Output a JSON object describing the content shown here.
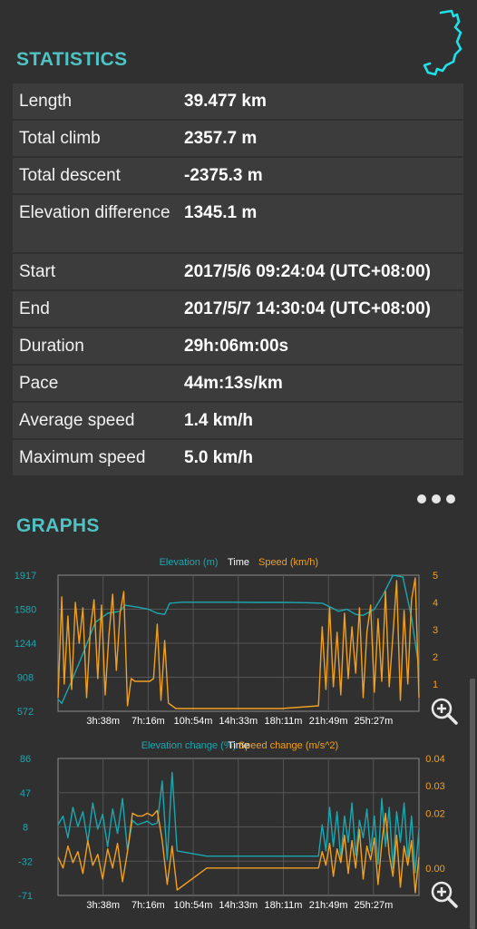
{
  "stats": {
    "title": "STATISTICS",
    "rows": [
      {
        "label": "Length",
        "value": "39.477 km"
      },
      {
        "label": "Total climb",
        "value": "2357.7 m"
      },
      {
        "label": "Total descent",
        "value": "-2375.3 m"
      },
      {
        "label": "Elevation difference",
        "value": "1345.1 m"
      },
      {
        "label": "Start",
        "value": "2017/5/6 09:24:04 (UTC+08:00)"
      },
      {
        "label": "End",
        "value": "2017/5/7 14:30:04 (UTC+08:00)"
      },
      {
        "label": "Duration",
        "value": "29h:06m:00s"
      },
      {
        "label": "Pace",
        "value": "44m:13s/km"
      },
      {
        "label": "Average speed",
        "value": "1.4 km/h"
      },
      {
        "label": "Maximum speed",
        "value": "5.0 km/h"
      }
    ]
  },
  "graphs": {
    "title": "GRAPHS"
  },
  "colors": {
    "accent": "#4fc3c3",
    "elevation": "#1aa7b0",
    "speed": "#f0a020",
    "row_bg": "#3c3c3c",
    "background": "#303030"
  },
  "chart_data": [
    {
      "type": "line",
      "legend": [
        "Elevation (m)",
        "Time",
        "Speed (km/h)"
      ],
      "x_ticks": [
        "3h:38m",
        "7h:16m",
        "10h:54m",
        "14h:33m",
        "18h:11m",
        "21h:49m",
        "25h:27m"
      ],
      "x_range_hours": [
        0,
        29.1
      ],
      "y_left_ticks": [
        "1917",
        "1580",
        "1244",
        "908",
        "572"
      ],
      "y_left_range": [
        572,
        1917
      ],
      "y_right_ticks": [
        "5",
        "4",
        "3",
        "2",
        "1"
      ],
      "y_right_range": [
        0,
        5
      ],
      "series": [
        {
          "name": "Elevation (m)",
          "axis": "left",
          "x": [
            0,
            0.3,
            1.2,
            2.2,
            3.0,
            4.0,
            5.0,
            5.4,
            6.5,
            7.3,
            8.0,
            8.6,
            9.0,
            10.0,
            12,
            14,
            16,
            18,
            20,
            21.3,
            22,
            22.6,
            23.3,
            24.0,
            24.6,
            25.5,
            26.2,
            27.0,
            27.8,
            28.5,
            29.1
          ],
          "y": [
            690,
            650,
            900,
            1200,
            1450,
            1540,
            1560,
            1620,
            1600,
            1580,
            1540,
            1530,
            1640,
            1650,
            1650,
            1650,
            1648,
            1648,
            1645,
            1640,
            1600,
            1560,
            1580,
            1530,
            1520,
            1580,
            1720,
            1920,
            1900,
            1500,
            1000
          ]
        },
        {
          "name": "Speed (km/h)",
          "axis": "right",
          "x": [
            0,
            0.3,
            0.5,
            0.8,
            1.1,
            1.4,
            1.7,
            2.0,
            2.3,
            2.6,
            2.9,
            3.2,
            3.5,
            3.8,
            4.1,
            4.4,
            4.7,
            5.0,
            5.3,
            5.6,
            5.9,
            6.2,
            6.5,
            6.8,
            7.1,
            7.4,
            7.7,
            8.0,
            8.3,
            8.6,
            8.9,
            9.5,
            12,
            15,
            18,
            21.0,
            21.3,
            21.6,
            21.9,
            22.2,
            22.5,
            22.8,
            23.1,
            23.4,
            23.7,
            24.0,
            24.3,
            24.6,
            24.9,
            25.2,
            25.5,
            25.8,
            26.1,
            26.4,
            26.7,
            27.0,
            27.3,
            27.6,
            27.9,
            28.2,
            28.5,
            28.8,
            29.1
          ],
          "y": [
            0.5,
            4.2,
            1.0,
            3.5,
            0.8,
            4.0,
            2.5,
            3.8,
            0.5,
            3.0,
            4.1,
            1.2,
            3.9,
            0.6,
            2.8,
            4.3,
            1.5,
            3.6,
            4.4,
            0.2,
            1.2,
            1.1,
            1.1,
            1.1,
            1.1,
            1.1,
            1.2,
            3.2,
            0.4,
            2.6,
            0.3,
            0.1,
            0.1,
            0.1,
            0.1,
            0.2,
            3.1,
            0.8,
            3.8,
            0.9,
            2.9,
            0.6,
            3.6,
            1.2,
            3.1,
            1.4,
            3.8,
            0.5,
            2.9,
            3.9,
            0.7,
            3.4,
            1.1,
            4.4,
            0.9,
            2.8,
            4.8,
            0.4,
            3.7,
            1.0,
            4.1,
            4.9,
            0.5
          ]
        }
      ]
    },
    {
      "type": "line",
      "legend": [
        "Elevation change (%)",
        "Time",
        "Speed change (m/s^2)"
      ],
      "x_ticks": [
        "3h:38m",
        "7h:16m",
        "10h:54m",
        "14h:33m",
        "18h:11m",
        "21h:49m",
        "25h:27m"
      ],
      "x_range_hours": [
        0,
        29.1
      ],
      "y_left_ticks": [
        "86",
        "47",
        "8",
        "-32",
        "-71"
      ],
      "y_left_range": [
        -71,
        86
      ],
      "y_right_ticks": [
        "0.04",
        "0.03",
        "0.02",
        "0.00"
      ],
      "y_right_range": [
        -0.01,
        0.04
      ],
      "series": [
        {
          "name": "Elevation change (%)",
          "axis": "left",
          "x": [
            0,
            0.4,
            0.8,
            1.2,
            1.6,
            2.0,
            2.4,
            2.8,
            3.2,
            3.6,
            4.0,
            4.4,
            4.8,
            5.2,
            5.6,
            6.0,
            6.4,
            6.8,
            7.2,
            7.6,
            8.0,
            8.4,
            8.8,
            9.2,
            9.6,
            12,
            15,
            18,
            21.0,
            21.3,
            21.6,
            21.9,
            22.2,
            22.5,
            22.8,
            23.1,
            23.4,
            23.7,
            24.0,
            24.3,
            24.6,
            24.9,
            25.2,
            25.5,
            25.8,
            26.1,
            26.4,
            26.7,
            27.0,
            27.3,
            27.6,
            27.9,
            28.2,
            28.5,
            28.8,
            29.1
          ],
          "y": [
            10,
            20,
            -5,
            30,
            8,
            25,
            -10,
            35,
            5,
            22,
            -15,
            28,
            0,
            40,
            -20,
            15,
            10,
            12,
            14,
            10,
            12,
            60,
            -30,
            70,
            -20,
            -26,
            -26,
            -26,
            -26,
            10,
            -20,
            30,
            -15,
            25,
            -30,
            20,
            -10,
            35,
            -25,
            15,
            -5,
            28,
            -20,
            20,
            -35,
            40,
            -15,
            30,
            -40,
            25,
            -10,
            35,
            -30,
            20,
            -45,
            5
          ]
        },
        {
          "name": "Speed change (m/s^2)",
          "axis": "right",
          "x": [
            0,
            0.4,
            0.8,
            1.2,
            1.6,
            2.0,
            2.4,
            2.8,
            3.2,
            3.6,
            4.0,
            4.4,
            4.8,
            5.2,
            5.6,
            6.0,
            6.4,
            6.8,
            7.2,
            7.6,
            8.0,
            8.4,
            8.8,
            9.2,
            9.6,
            12,
            15,
            18,
            21.0,
            21.3,
            21.6,
            21.9,
            22.2,
            22.5,
            22.8,
            23.1,
            23.4,
            23.7,
            24.0,
            24.3,
            24.6,
            24.9,
            25.2,
            25.5,
            25.8,
            26.1,
            26.4,
            26.7,
            27.0,
            27.3,
            27.6,
            27.9,
            28.2,
            28.5,
            28.8,
            29.1
          ],
          "y": [
            0.004,
            0.0,
            0.008,
            0.002,
            0.006,
            -0.002,
            0.01,
            0.001,
            0.005,
            -0.004,
            0.007,
            0.0,
            0.009,
            -0.005,
            0.006,
            0.02,
            0.019,
            0.019,
            0.02,
            0.019,
            0.021,
            0.01,
            -0.006,
            0.008,
            -0.008,
            0.0,
            0.0,
            0.0,
            0.0,
            0.006,
            0.001,
            0.009,
            -0.003,
            0.007,
            0.002,
            0.012,
            -0.002,
            0.01,
            0.0,
            0.014,
            -0.004,
            0.008,
            0.003,
            0.011,
            -0.006,
            0.009,
            0.02,
            0.005,
            -0.003,
            0.012,
            -0.007,
            0.008,
            0.001,
            0.01,
            -0.009,
            0.004
          ]
        }
      ]
    }
  ]
}
